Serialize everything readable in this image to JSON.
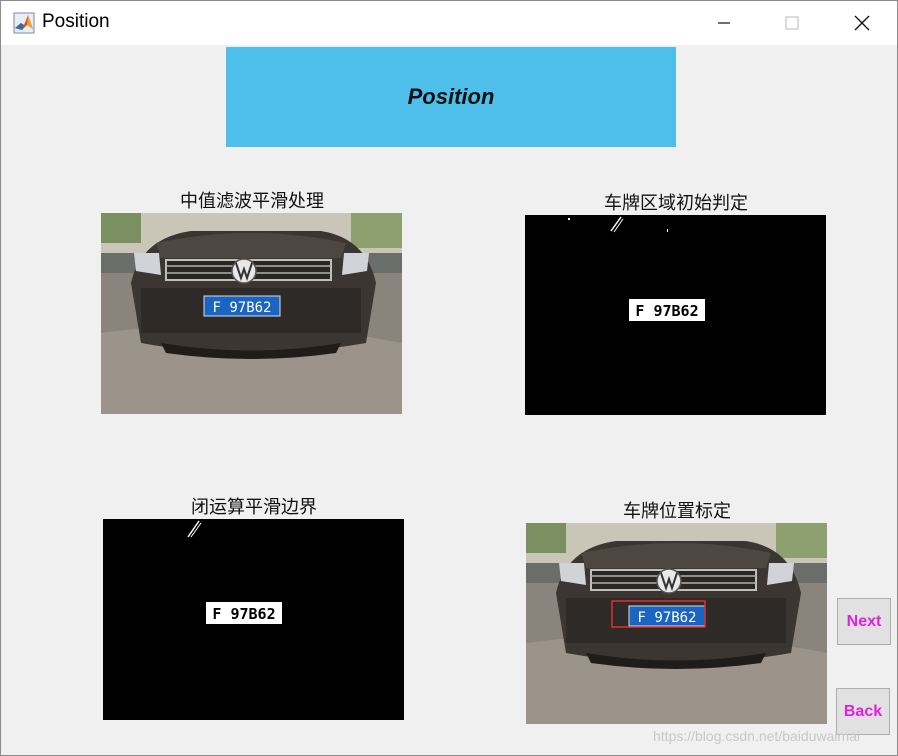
{
  "window": {
    "title": "Position",
    "icon": "matlab-icon",
    "controls": [
      "minimize-icon",
      "maximize-icon",
      "close-icon"
    ]
  },
  "banner": {
    "text": "Position",
    "color": "#4dbfea"
  },
  "panels": [
    {
      "title": "中值滤波平滑处理",
      "image": "car-photo-filtered"
    },
    {
      "title": "车牌区域初始判定",
      "image": "binary-plate-mask",
      "plate_text": "F 97B62"
    },
    {
      "title": "闭运算平滑边界",
      "image": "binary-plate-mask-closed",
      "plate_text": "F 97B62"
    },
    {
      "title": "车牌位置标定",
      "image": "car-photo-plate-located"
    }
  ],
  "car_plate_text": "F 97B62",
  "buttons": {
    "next": "Next",
    "back": "Back",
    "label_color": "#e020e0"
  },
  "watermark": "https://blog.csdn.net/baiduwaimai"
}
